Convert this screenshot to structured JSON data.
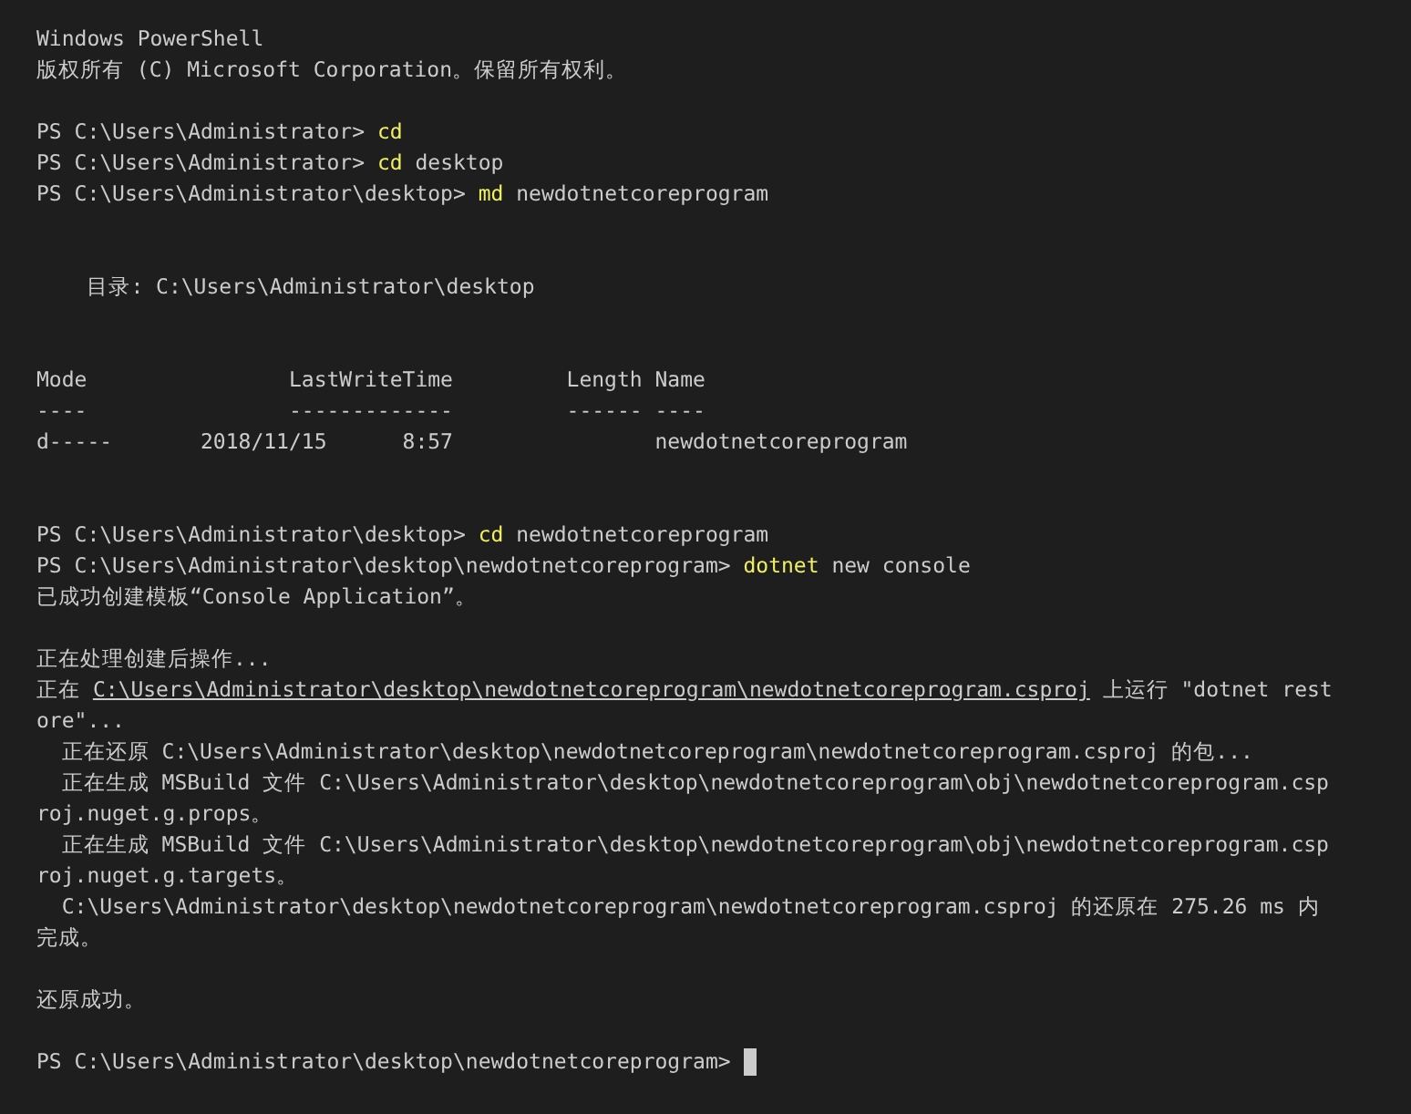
{
  "terminal": {
    "lines": [
      {
        "kind": "text",
        "segments": [
          {
            "kind": "plain",
            "text": "Windows PowerShell"
          }
        ]
      },
      {
        "kind": "text",
        "segments": [
          {
            "kind": "plain",
            "text": "版权所有 (C) Microsoft Corporation。保留所有权利。"
          }
        ]
      },
      {
        "kind": "blank"
      },
      {
        "kind": "text",
        "segments": [
          {
            "kind": "prompt",
            "text": "PS C:\\Users\\Administrator> "
          },
          {
            "kind": "command",
            "text": "cd"
          }
        ]
      },
      {
        "kind": "text",
        "segments": [
          {
            "kind": "prompt",
            "text": "PS C:\\Users\\Administrator> "
          },
          {
            "kind": "command",
            "text": "cd"
          },
          {
            "kind": "argument",
            "text": " desktop"
          }
        ]
      },
      {
        "kind": "text",
        "segments": [
          {
            "kind": "prompt",
            "text": "PS C:\\Users\\Administrator\\desktop> "
          },
          {
            "kind": "command",
            "text": "md"
          },
          {
            "kind": "argument",
            "text": " newdotnetcoreprogram"
          }
        ]
      },
      {
        "kind": "blank"
      },
      {
        "kind": "blank"
      },
      {
        "kind": "text",
        "segments": [
          {
            "kind": "plain",
            "text": "    目录: C:\\Users\\Administrator\\desktop"
          }
        ]
      },
      {
        "kind": "blank"
      },
      {
        "kind": "blank"
      },
      {
        "kind": "text",
        "segments": [
          {
            "kind": "plain",
            "text": "Mode                LastWriteTime         Length Name"
          }
        ]
      },
      {
        "kind": "text",
        "segments": [
          {
            "kind": "plain",
            "text": "----                -------------         ------ ----"
          }
        ]
      },
      {
        "kind": "text",
        "segments": [
          {
            "kind": "plain",
            "text": "d-----       2018/11/15      8:57                newdotnetcoreprogram"
          }
        ]
      },
      {
        "kind": "blank"
      },
      {
        "kind": "blank"
      },
      {
        "kind": "text",
        "segments": [
          {
            "kind": "prompt",
            "text": "PS C:\\Users\\Administrator\\desktop> "
          },
          {
            "kind": "command",
            "text": "cd"
          },
          {
            "kind": "argument",
            "text": " newdotnetcoreprogram"
          }
        ]
      },
      {
        "kind": "text",
        "segments": [
          {
            "kind": "prompt",
            "text": "PS C:\\Users\\Administrator\\desktop\\newdotnetcoreprogram> "
          },
          {
            "kind": "command",
            "text": "dotnet"
          },
          {
            "kind": "argument",
            "text": " new console"
          }
        ]
      },
      {
        "kind": "text",
        "segments": [
          {
            "kind": "plain",
            "text": "已成功创建模板“Console Application”。"
          }
        ]
      },
      {
        "kind": "blank"
      },
      {
        "kind": "text",
        "segments": [
          {
            "kind": "plain",
            "text": "正在处理创建后操作..."
          }
        ]
      },
      {
        "kind": "text",
        "segments": [
          {
            "kind": "plain",
            "text": "正在 "
          },
          {
            "kind": "link",
            "text": "C:\\Users\\Administrator\\desktop\\newdotnetcoreprogram\\newdotnetcoreprogram.csproj"
          },
          {
            "kind": "plain",
            "text": " 上运行 \"dotnet rest"
          }
        ]
      },
      {
        "kind": "text",
        "segments": [
          {
            "kind": "plain",
            "text": "ore\"..."
          }
        ]
      },
      {
        "kind": "text",
        "segments": [
          {
            "kind": "plain",
            "text": "  正在还原 C:\\Users\\Administrator\\desktop\\newdotnetcoreprogram\\newdotnetcoreprogram.csproj 的包..."
          }
        ]
      },
      {
        "kind": "text",
        "segments": [
          {
            "kind": "plain",
            "text": "  正在生成 MSBuild 文件 C:\\Users\\Administrator\\desktop\\newdotnetcoreprogram\\obj\\newdotnetcoreprogram.csp"
          }
        ]
      },
      {
        "kind": "text",
        "segments": [
          {
            "kind": "plain",
            "text": "roj.nuget.g.props。"
          }
        ]
      },
      {
        "kind": "text",
        "segments": [
          {
            "kind": "plain",
            "text": "  正在生成 MSBuild 文件 C:\\Users\\Administrator\\desktop\\newdotnetcoreprogram\\obj\\newdotnetcoreprogram.csp"
          }
        ]
      },
      {
        "kind": "text",
        "segments": [
          {
            "kind": "plain",
            "text": "roj.nuget.g.targets。"
          }
        ]
      },
      {
        "kind": "text",
        "segments": [
          {
            "kind": "plain",
            "text": "  C:\\Users\\Administrator\\desktop\\newdotnetcoreprogram\\newdotnetcoreprogram.csproj 的还原在 275.26 ms 内"
          }
        ]
      },
      {
        "kind": "text",
        "segments": [
          {
            "kind": "plain",
            "text": "完成。"
          }
        ]
      },
      {
        "kind": "blank"
      },
      {
        "kind": "text",
        "segments": [
          {
            "kind": "plain",
            "text": "还原成功。"
          }
        ]
      },
      {
        "kind": "blank"
      },
      {
        "kind": "text",
        "cursor": true,
        "segments": [
          {
            "kind": "prompt",
            "text": "PS C:\\Users\\Administrator\\desktop\\newdotnetcoreprogram> "
          }
        ]
      }
    ]
  }
}
